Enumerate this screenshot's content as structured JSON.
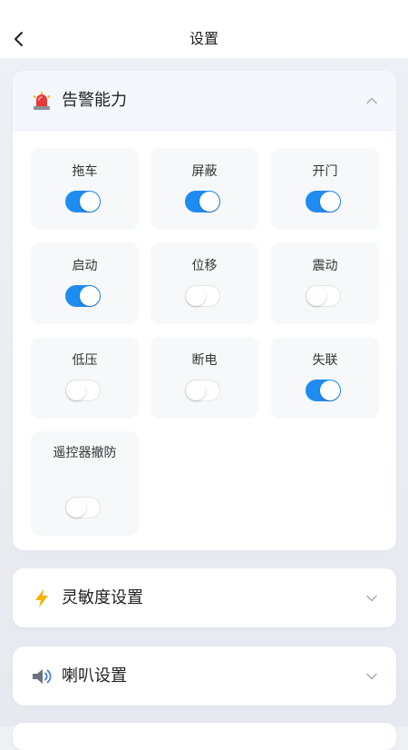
{
  "header": {
    "title": "设置",
    "back_icon": "chevron-left-icon"
  },
  "sections": [
    {
      "title": "告警能力",
      "icon": "siren-icon",
      "expanded": true,
      "chevron_icon": "chevron-up-icon",
      "items": [
        {
          "label": "拖车",
          "enabled": true
        },
        {
          "label": "屏蔽",
          "enabled": true
        },
        {
          "label": "开门",
          "enabled": true
        },
        {
          "label": "启动",
          "enabled": true
        },
        {
          "label": "位移",
          "enabled": false
        },
        {
          "label": "震动",
          "enabled": false
        },
        {
          "label": "低压",
          "enabled": false
        },
        {
          "label": "断电",
          "enabled": false
        },
        {
          "label": "失联",
          "enabled": true
        },
        {
          "label": "遥控器撤防",
          "enabled": false
        }
      ]
    },
    {
      "title": "灵敏度设置",
      "icon": "lightning-icon",
      "expanded": false,
      "chevron_icon": "chevron-down-icon"
    },
    {
      "title": "喇叭设置",
      "icon": "speaker-icon",
      "expanded": false,
      "chevron_icon": "chevron-down-icon"
    }
  ],
  "colors": {
    "toggle_on": "#1f8cf1",
    "toggle_off": "#ffffff",
    "siren_red": "#e53935",
    "lightning_yellow": "#f5b300",
    "speaker_blue": "#4a7fd8"
  }
}
